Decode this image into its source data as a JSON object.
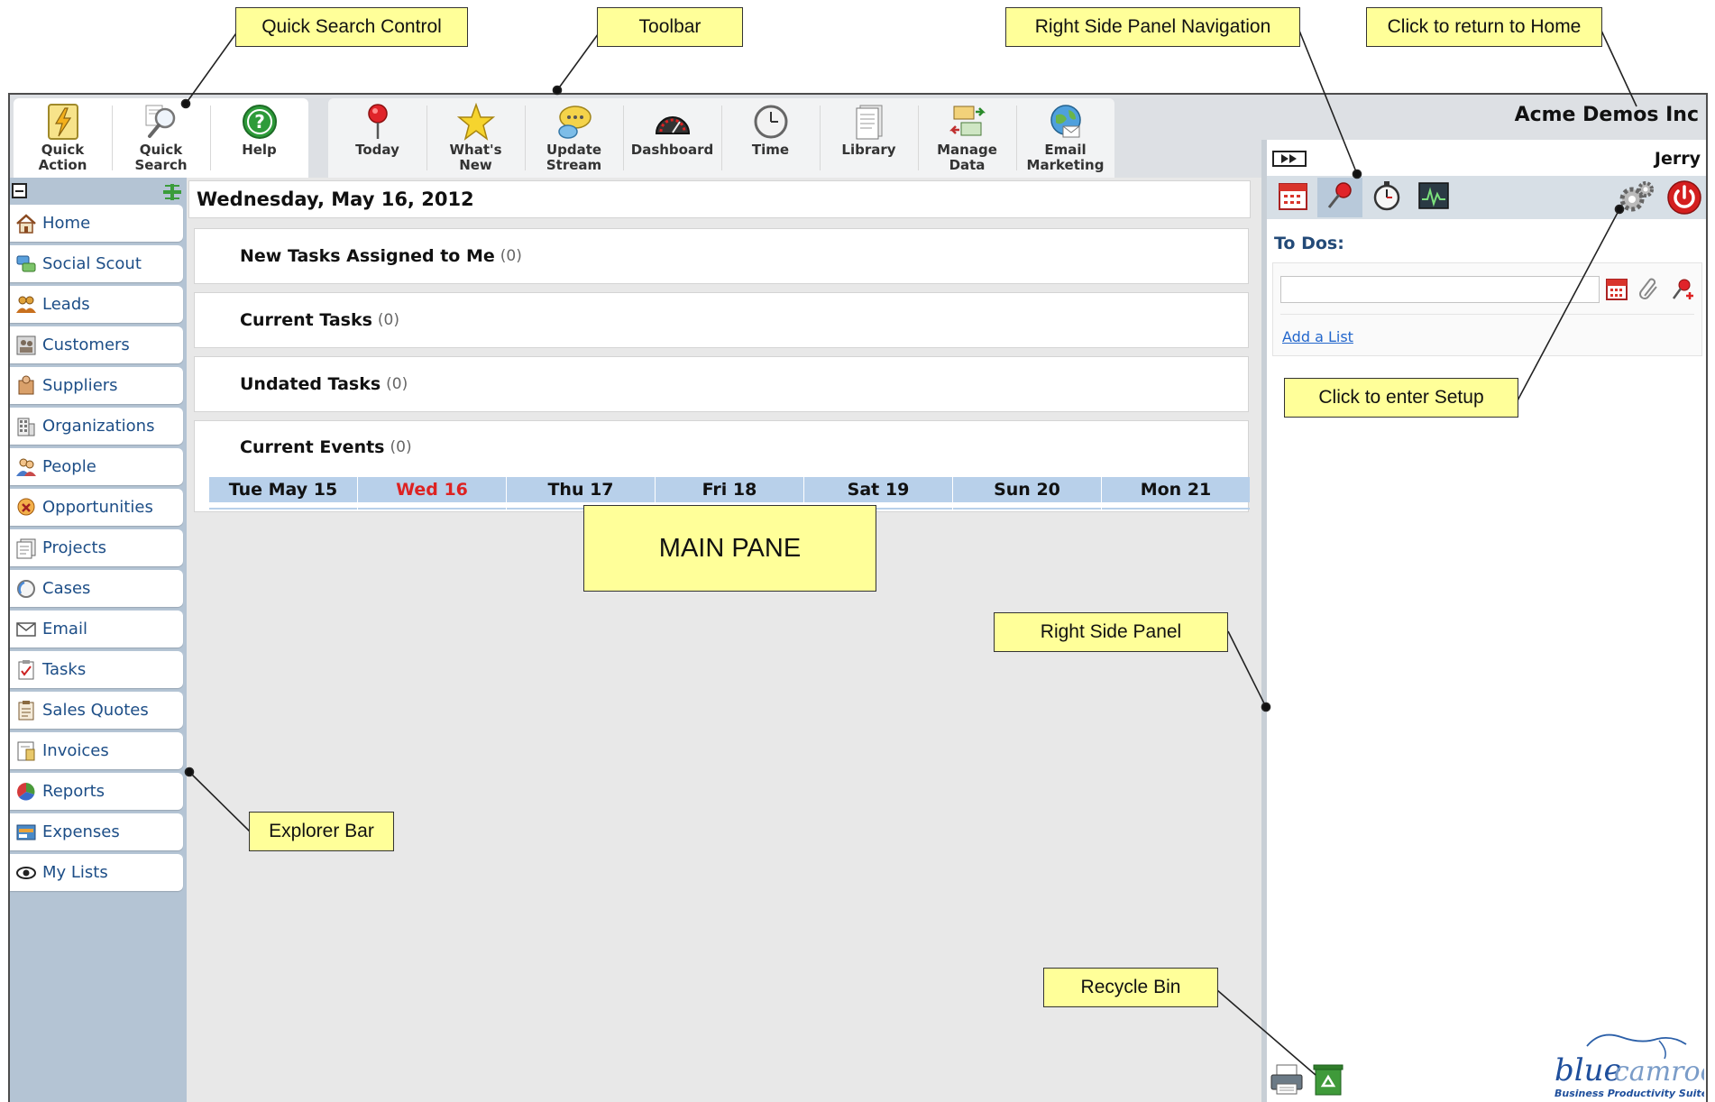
{
  "company": "Acme Demos Inc",
  "user": "Jerry",
  "toolbar": {
    "quick_action": "Quick\nAction",
    "quick_search": "Quick\nSearch",
    "help": "Help",
    "today": "Today",
    "whats_new": "What's\nNew",
    "update_stream": "Update\nStream",
    "dashboard": "Dashboard",
    "time": "Time",
    "library": "Library",
    "manage_data": "Manage\nData",
    "email_marketing": "Email\nMarketing"
  },
  "explorer": {
    "items": [
      {
        "label": "Home",
        "icon": "home-icon"
      },
      {
        "label": "Social Scout",
        "icon": "social-scout-icon"
      },
      {
        "label": "Leads",
        "icon": "leads-icon"
      },
      {
        "label": "Customers",
        "icon": "customers-icon"
      },
      {
        "label": "Suppliers",
        "icon": "suppliers-icon"
      },
      {
        "label": "Organizations",
        "icon": "organizations-icon"
      },
      {
        "label": "People",
        "icon": "people-icon"
      },
      {
        "label": "Opportunities",
        "icon": "opportunities-icon"
      },
      {
        "label": "Projects",
        "icon": "projects-icon"
      },
      {
        "label": "Cases",
        "icon": "cases-icon"
      },
      {
        "label": "Email",
        "icon": "email-icon"
      },
      {
        "label": "Tasks",
        "icon": "tasks-icon"
      },
      {
        "label": "Sales Quotes",
        "icon": "sales-quotes-icon"
      },
      {
        "label": "Invoices",
        "icon": "invoices-icon"
      },
      {
        "label": "Reports",
        "icon": "reports-icon"
      },
      {
        "label": "Expenses",
        "icon": "expenses-icon"
      },
      {
        "label": "My Lists",
        "icon": "my-lists-icon"
      }
    ]
  },
  "main": {
    "date": "Wednesday, May 16, 2012",
    "sections": [
      {
        "title": "New Tasks Assigned to Me",
        "count": "(0)"
      },
      {
        "title": "Current Tasks",
        "count": "(0)"
      },
      {
        "title": "Undated Tasks",
        "count": "(0)"
      },
      {
        "title": "Current Events",
        "count": "(0)"
      }
    ],
    "week": [
      "Tue May 15",
      "Wed 16",
      "Thu 17",
      "Fri 18",
      "Sat 19",
      "Sun 20",
      "Mon 21"
    ],
    "today_index": 1
  },
  "right_panel": {
    "todos_title": "To Dos:",
    "todo_input_value": "",
    "add_list": "Add a List"
  },
  "logo": {
    "word1": "blue",
    "word2": "camroo",
    "tagline": "Business Productivity Suite"
  },
  "callouts": {
    "quick_search_control": "Quick Search Control",
    "toolbar": "Toolbar",
    "right_side_panel_navigation": "Right Side Panel Navigation",
    "click_home": "Click to return to Home",
    "click_setup": "Click to enter Setup",
    "main_pane": "MAIN PANE",
    "right_side_panel": "Right Side Panel",
    "explorer_bar": "Explorer Bar",
    "recycle_bin": "Recycle Bin"
  },
  "colors": {
    "explorer_bg": "#b4c4d4",
    "nav_text": "#1d4e87",
    "day_header": "#b8d0ea",
    "today_text": "#dd2222",
    "callout_bg": "#ffff99"
  }
}
